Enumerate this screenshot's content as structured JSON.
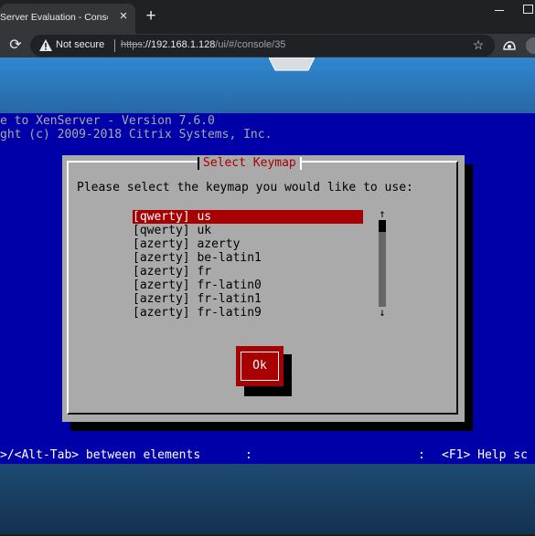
{
  "browser": {
    "tab_title": "Server Evaluation - Console -",
    "tab_close": "×",
    "new_tab": "+",
    "security_label": "Not secure",
    "url_scheme": "https",
    "url_host": "://192.168.1.128",
    "url_path": "/ui/#/console/35",
    "reload_icon": "refresh-icon",
    "star_icon": "star-icon"
  },
  "console": {
    "welcome_line1": "e to XenServer - Version 7.6.0",
    "welcome_line2": "ght (c) 2009-2018 Citrix Systems, Inc.",
    "dialog": {
      "title": "Select Keymap",
      "prompt": "Please select the keymap you would like to use:",
      "items": [
        {
          "label": "[qwerty] us",
          "selected": true
        },
        {
          "label": "[qwerty] uk"
        },
        {
          "label": "[azerty] azerty"
        },
        {
          "label": "[azerty] be-latin1"
        },
        {
          "label": "[azerty] fr"
        },
        {
          "label": "[azerty] fr-latin0"
        },
        {
          "label": "[azerty] fr-latin1"
        },
        {
          "label": "[azerty] fr-latin9"
        }
      ],
      "scroll_up": "↑",
      "scroll_down": "↓",
      "ok_label": "Ok"
    },
    "status_left": ">/<Alt-Tab> between elements",
    "status_sep": ":",
    "status_right": "<F1> Help sc"
  },
  "colors": {
    "console_bg": "#0000a8",
    "dialog_bg": "#aaaaaa",
    "accent_red": "#a80000"
  }
}
